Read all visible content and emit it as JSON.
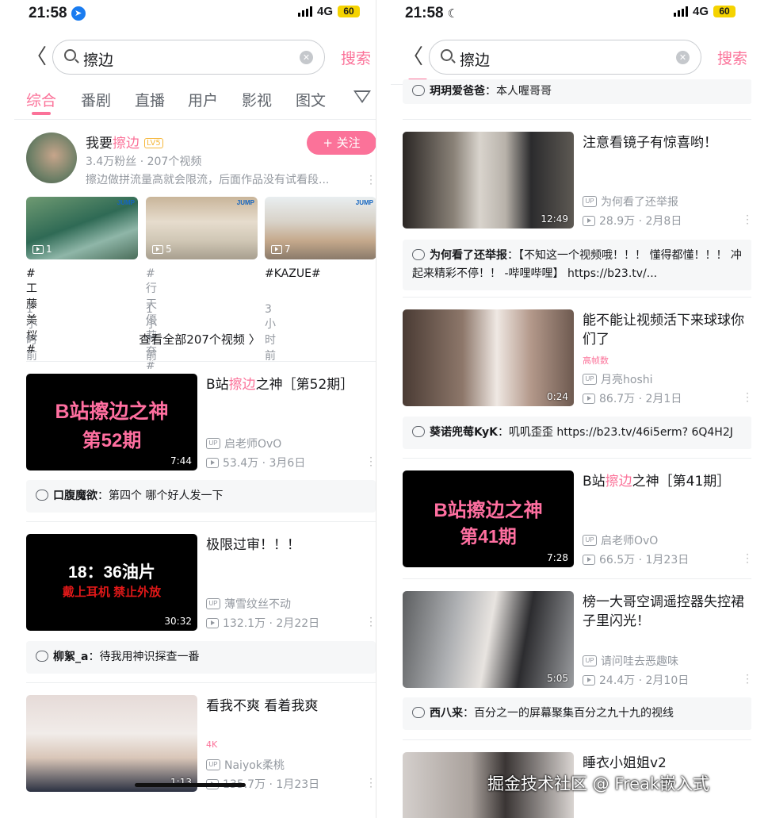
{
  "left": {
    "status": {
      "time": "21:58",
      "network": "4G",
      "battery": "60",
      "indicator": "location-arrow-icon"
    },
    "search": {
      "query": "擦边",
      "button": "搜索"
    },
    "tabs": [
      {
        "label": "综合",
        "active": true
      },
      {
        "label": "番剧"
      },
      {
        "label": "直播"
      },
      {
        "label": "用户"
      },
      {
        "label": "影视"
      },
      {
        "label": "图文"
      }
    ],
    "uploader": {
      "name_prefix": "我要",
      "name_highlight": "擦边",
      "level": "LV5",
      "meta": "3.4万粉丝 · 207个视频",
      "desc": "擦边做拼流量高就会限流，后面作品没有试看段...",
      "follow": "+ 关注",
      "mini_videos": [
        {
          "count": "1",
          "title": "#工藤美桜#",
          "time": "1小时前"
        },
        {
          "count": "5",
          "title": "#行天優莉奈#",
          "time": "1小时前"
        },
        {
          "count": "7",
          "title": "#KAZUE#",
          "time": "3小时前"
        }
      ],
      "see_all": "查看全部207个视频 〉"
    },
    "videos": [
      {
        "title_prefix": "B站",
        "title_hl": "擦边",
        "title_suffix": "之神［第52期］",
        "thumb_line1": "B站擦边之神",
        "thumb_line2": "第52期",
        "duration": "7:44",
        "up": "启老师OvO",
        "stats": "53.4万 · 3月6日",
        "comment": {
          "user": "口腹魔欲",
          "text": "：第四个 哪个好人发一下"
        }
      },
      {
        "title": "极限过审！！！",
        "thumb_line1": "18：36油片",
        "thumb_line2": "戴上耳机 禁止外放",
        "duration": "30:32",
        "up": "薄雪纹丝不动",
        "stats": "132.1万 · 2月22日",
        "comment": {
          "user": "柳絮_a",
          "text": "：待我用神识探查一番"
        }
      },
      {
        "title": "看我不爽 看着我爽",
        "tag": "4K",
        "duration": "1:13",
        "up": "Naiyok柔桃",
        "stats": "135.7万 · 1月23日"
      }
    ]
  },
  "right": {
    "status": {
      "time": "21:58",
      "network": "4G",
      "battery": "60",
      "indicator": "moon-icon"
    },
    "search": {
      "query": "擦边",
      "button": "搜索"
    },
    "top_comment": {
      "user": "玥玥爱爸爸",
      "text": "：本人喔哥哥"
    },
    "videos": [
      {
        "title": "注意看镜子有惊喜哟！",
        "duration": "12:49",
        "up": "为何看了还举报",
        "stats": "28.9万 · 2月8日",
        "comment": {
          "user": "为何看了还举报",
          "text": "：【不知这一个视频哦！！！ 懂得都懂！！！ 冲起来精彩不停！！ -哔哩哔哩】 https://b23.tv/..."
        }
      },
      {
        "title": "能不能让视频活下来球球你们了",
        "tag": "高帧数",
        "duration": "0:24",
        "up": "月亮hoshi",
        "stats": "86.7万 · 2月1日",
        "comment": {
          "user": "葵诺兜莓KyK",
          "text": "：叽叽歪歪 https://b23.tv/46i5erm? 6Q4H2J"
        }
      },
      {
        "title_prefix": "B站",
        "title_hl": "擦边",
        "title_suffix": "之神［第41期］",
        "thumb_line1": "B站擦边之神",
        "thumb_line2": "第41期",
        "duration": "7:28",
        "up": "启老师OvO",
        "stats": "66.5万 · 1月23日"
      },
      {
        "title": "榜一大哥空调遥控器失控裙子里闪光！",
        "duration": "5:05",
        "up": "请问哇去恶趣味",
        "stats": "24.4万 · 2月10日",
        "comment": {
          "user": "西八来",
          "text": "：百分之一的屏幕聚集百分之九十九的视线"
        }
      },
      {
        "title": "睡衣小姐姐v2"
      }
    ],
    "watermark": "掘金技术社区 @ Freak嵌入式"
  }
}
